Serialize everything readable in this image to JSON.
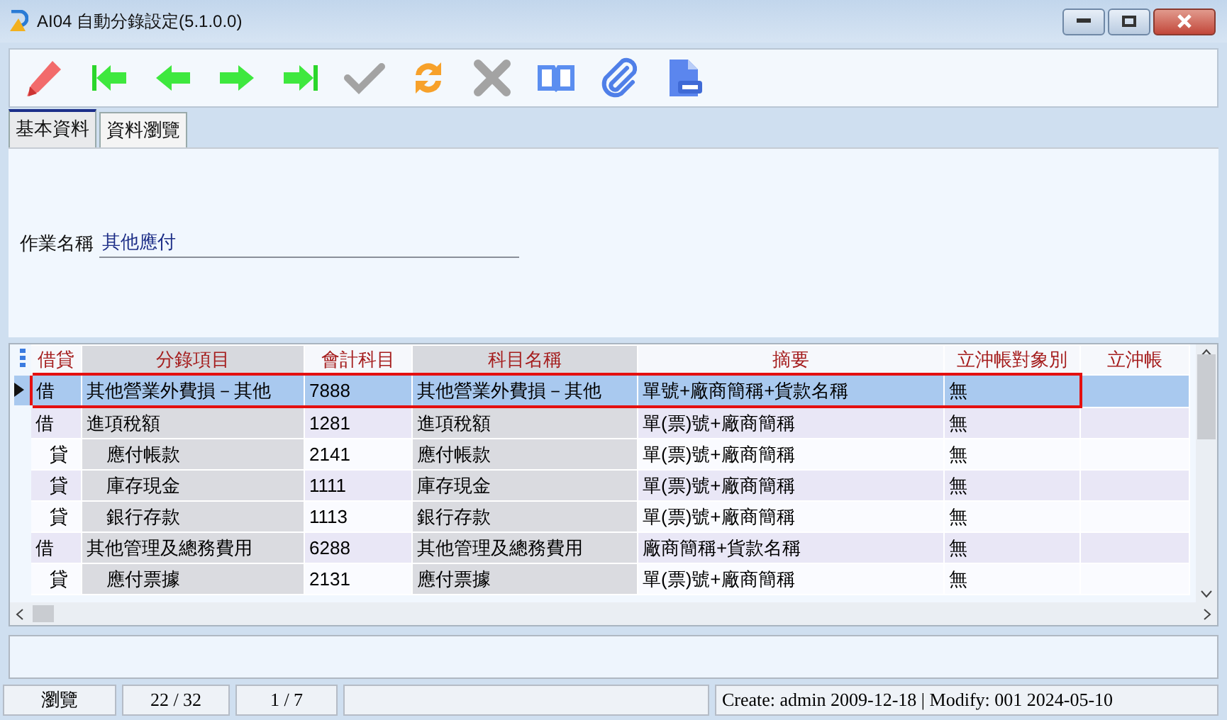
{
  "window": {
    "title": "AI04 自動分錄設定(5.1.0.0)"
  },
  "toolbar": [
    {
      "kind": "edit",
      "disabled": false
    },
    {
      "kind": "first",
      "disabled": false
    },
    {
      "kind": "prev",
      "disabled": false
    },
    {
      "kind": "next",
      "disabled": false
    },
    {
      "kind": "last",
      "disabled": false
    },
    {
      "kind": "confirm",
      "disabled": true
    },
    {
      "kind": "refresh",
      "disabled": false
    },
    {
      "kind": "cancel",
      "disabled": true
    },
    {
      "kind": "book",
      "disabled": false
    },
    {
      "kind": "attach",
      "disabled": false
    },
    {
      "kind": "excel",
      "disabled": false
    }
  ],
  "tabs": [
    {
      "label": "基本資料",
      "selected": true
    },
    {
      "label": "資料瀏覽",
      "selected": false
    }
  ],
  "form": {
    "label": "作業名稱",
    "value": "其他應付"
  },
  "table": {
    "columns": [
      {
        "label": "借貸",
        "kind": "text"
      },
      {
        "label": "分錄項目",
        "kind": "lookup"
      },
      {
        "label": "會計科目",
        "kind": "text"
      },
      {
        "label": "科目名稱",
        "kind": "lookup"
      },
      {
        "label": "摘要",
        "kind": "text"
      },
      {
        "label": "立沖帳對象別",
        "kind": "text"
      },
      {
        "label": "立沖帳",
        "kind": "text"
      }
    ],
    "rows": [
      {
        "selected": true,
        "kind": "debit",
        "cells": [
          "借",
          "其他營業外費損－其他",
          "7888",
          "其他營業外費損－其他",
          "單號+廠商簡稱+貨款名稱",
          "無"
        ]
      },
      {
        "selected": false,
        "kind": "debit",
        "cells": [
          "借",
          "進項稅額",
          "1281",
          "進項稅額",
          "單(票)號+廠商簡稱",
          "無"
        ]
      },
      {
        "selected": false,
        "kind": "credit",
        "cells": [
          "貸",
          "應付帳款",
          "2141",
          "應付帳款",
          "單(票)號+廠商簡稱",
          "無"
        ]
      },
      {
        "selected": false,
        "kind": "credit",
        "cells": [
          "貸",
          "庫存現金",
          "1111",
          "庫存現金",
          "單(票)號+廠商簡稱",
          "無"
        ]
      },
      {
        "selected": false,
        "kind": "credit",
        "cells": [
          "貸",
          "銀行存款",
          "1113",
          "銀行存款",
          "單(票)號+廠商簡稱",
          "無"
        ]
      },
      {
        "selected": false,
        "kind": "debit",
        "cells": [
          "借",
          "其他管理及總務費用",
          "6288",
          "其他管理及總務費用",
          "廠商簡稱+貨款名稱",
          "無"
        ]
      },
      {
        "selected": false,
        "kind": "credit",
        "cells": [
          "貸",
          "應付票據",
          "2131",
          "應付票據",
          "單(票)號+廠商簡稱",
          "無"
        ]
      }
    ]
  },
  "status_bar": [
    "瀏覽",
    "22 / 32",
    "1 / 7",
    "Create: admin 2009-12-18 | Modify: 001 2024-05-10"
  ]
}
